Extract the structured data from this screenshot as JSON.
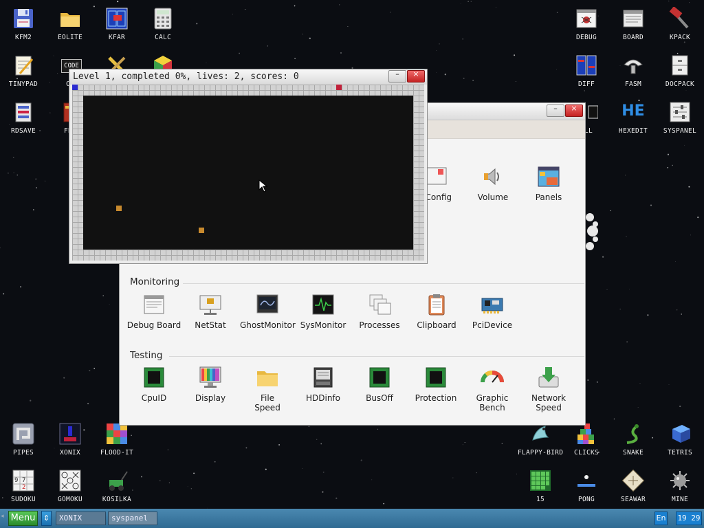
{
  "desktop": {
    "icons_left": [
      {
        "label": "KFM2",
        "icon": "floppy-icon"
      },
      {
        "label": "EOLITE",
        "icon": "folder-icon"
      },
      {
        "label": "KFAR",
        "icon": "kfar-icon"
      },
      {
        "label": "CALC",
        "icon": "calculator-icon"
      },
      {
        "label": "TINYPAD",
        "icon": "notepad-icon"
      },
      {
        "label": "CE",
        "icon": "code-icon"
      },
      {
        "label": "RDSAVE",
        "icon": "rdsave-icon"
      },
      {
        "label": "FB2",
        "icon": "book-icon"
      }
    ],
    "icons_right": [
      {
        "label": "DEBUG",
        "icon": "debug-icon"
      },
      {
        "label": "BOARD",
        "icon": "board-icon"
      },
      {
        "label": "KPACK",
        "icon": "hammer-icon"
      },
      {
        "label": "DIFF",
        "icon": "diff-icon"
      },
      {
        "label": "FASM",
        "icon": "fasm-icon"
      },
      {
        "label": "DOCPACK",
        "icon": "cabinet-icon"
      },
      {
        "label": "ELL",
        "icon": "shell-icon"
      },
      {
        "label": "HEXEDIT",
        "icon": "hexedit-icon"
      },
      {
        "label": "SYSPANEL",
        "icon": "sliders-icon"
      }
    ],
    "icons_bottom": [
      {
        "label": "PIPES",
        "icon": "pipes-icon"
      },
      {
        "label": "XONIX",
        "icon": "xonix-icon"
      },
      {
        "label": "FLOOD-IT",
        "icon": "flood-icon"
      },
      {
        "label": "FLAPPY-BIRD",
        "icon": "bird-icon"
      },
      {
        "label": "CLICKS",
        "icon": "clicks-icon"
      },
      {
        "label": "SNAKE",
        "icon": "snake-icon"
      },
      {
        "label": "TETRIS",
        "icon": "tetris-icon"
      },
      {
        "label": "SUDOKU",
        "icon": "sudoku-icon"
      },
      {
        "label": "GOMOKU",
        "icon": "gomoku-icon"
      },
      {
        "label": "KOSILKA",
        "icon": "mower-icon"
      },
      {
        "label": "15",
        "icon": "fifteen-icon"
      },
      {
        "label": "PONG",
        "icon": "pong-icon"
      },
      {
        "label": "SEAWAR",
        "icon": "seawar-icon"
      },
      {
        "label": "MINE",
        "icon": "mine-icon"
      }
    ],
    "sudoku_digits": [
      "9",
      "7",
      "2"
    ],
    "code_icon_text": "CODE",
    "hexedit_text": "HE"
  },
  "game_window": {
    "title": "Level 1, completed 0%, lives: 2, scores: 0",
    "minimize_label": "–",
    "close_label": "×",
    "colors": {
      "border": "#d2d2d2",
      "pit": "#111111",
      "enemy": "#c88a2e",
      "player": "#2b2bd0",
      "border_enemy": "#c0213a"
    }
  },
  "syspanel_window": {
    "minimize_label": "–",
    "close_label": "×",
    "top_row": [
      {
        "label": "nConfig",
        "icon": "config-icon"
      },
      {
        "label": "Volume",
        "icon": "speaker-icon"
      },
      {
        "label": "Panels",
        "icon": "panels-icon"
      }
    ],
    "sections": [
      {
        "title": "Monitoring",
        "items": [
          {
            "label": "Debug Board",
            "icon": "debug-board-icon"
          },
          {
            "label": "NetStat",
            "icon": "network-icon"
          },
          {
            "label": "GhostMonitor",
            "icon": "ghost-monitor-icon"
          },
          {
            "label": "SysMonitor",
            "icon": "sys-monitor-icon"
          },
          {
            "label": "Processes",
            "icon": "processes-icon"
          },
          {
            "label": "Clipboard",
            "icon": "clipboard-icon"
          },
          {
            "label": "PciDevice",
            "icon": "pci-icon"
          }
        ]
      },
      {
        "title": "Testing",
        "items": [
          {
            "label": "CpuID",
            "icon": "chip-icon"
          },
          {
            "label": "Display",
            "icon": "display-icon"
          },
          {
            "label": "File Speed",
            "icon": "folder-icon"
          },
          {
            "label": "HDDinfo",
            "icon": "hdd-icon"
          },
          {
            "label": "BusOff",
            "icon": "chip-icon"
          },
          {
            "label": "Protection",
            "icon": "chip-icon"
          },
          {
            "label": "Graphic Bench",
            "icon": "gauge-icon"
          },
          {
            "label": "Network Speed",
            "icon": "download-icon"
          }
        ]
      }
    ]
  },
  "taskbar": {
    "menu_label": "Menu",
    "switch_label": "⇕",
    "tasks": [
      "XONIX",
      "syspanel"
    ],
    "lang": "En",
    "clock": "19 29"
  }
}
